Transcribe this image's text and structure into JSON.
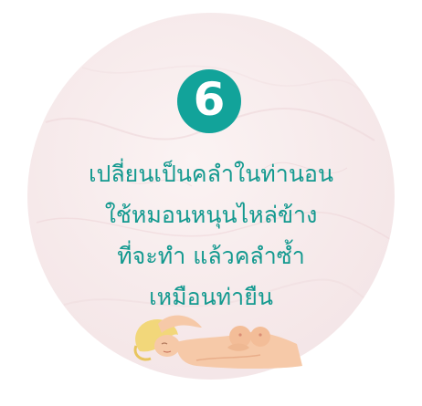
{
  "step": {
    "number": "6",
    "badge_color": "#12a39a"
  },
  "instruction": {
    "lines": [
      "เปลี่ยนเป็นคลำในท่านอน",
      "ใช้หมอนหนุนไหล่ข้าง",
      "ที่จะทำ แล้วคลำซ้ำ",
      "เหมือนท่ายืน"
    ],
    "text_color": "#13998f"
  },
  "illustration": {
    "icon": "woman-lying-down-illustration",
    "hair_color": "#f2d77a",
    "skin_color": "#f6c9a8"
  },
  "background": {
    "circle_color": "#f6e9ea"
  }
}
